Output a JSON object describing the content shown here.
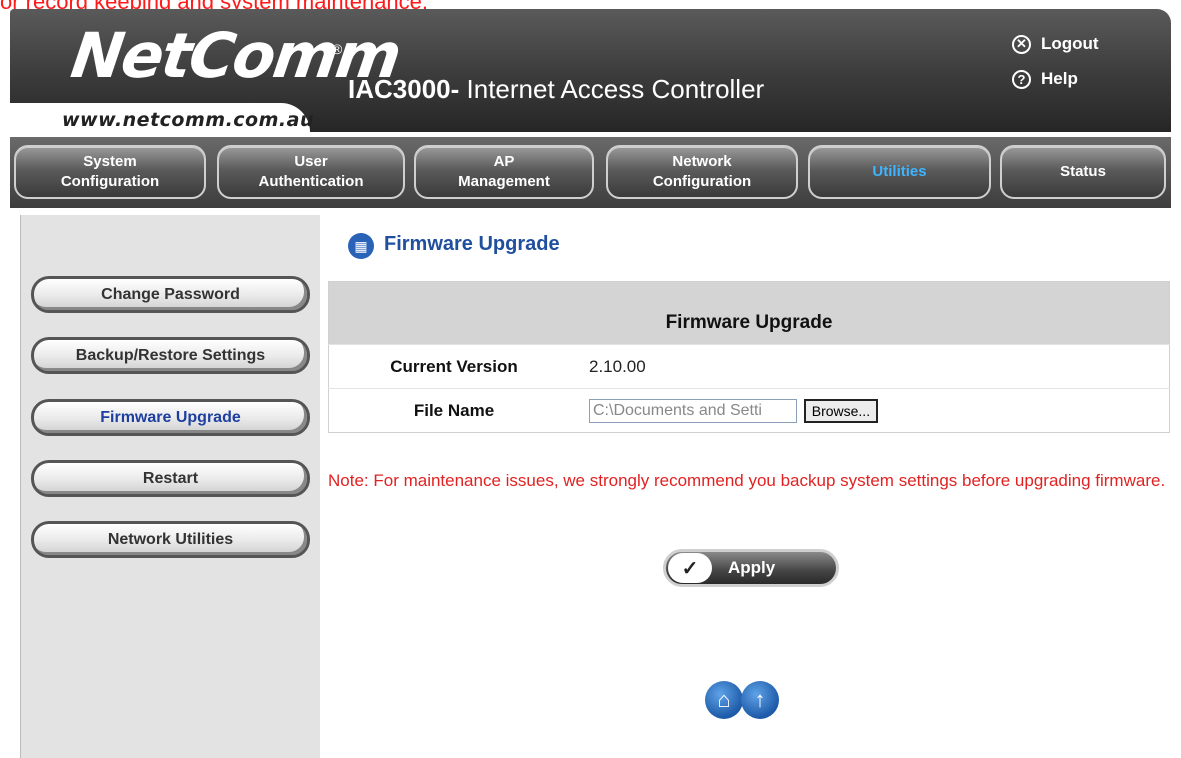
{
  "caption_top": "or record keeping and system maintenance.",
  "header": {
    "logo": "NetComm",
    "logo_reg": "®",
    "url": "www.netcomm.com.au",
    "product_bold": "IAC3000-",
    "product_rest": " Internet Access Controller",
    "logout_icon": "x-circle-icon",
    "logout": "Logout",
    "help_icon": "question-circle-icon",
    "help": "Help"
  },
  "tabs": [
    {
      "label_1": "System",
      "label_2": "Configuration"
    },
    {
      "label_1": "User",
      "label_2": "Authentication"
    },
    {
      "label_1": "AP",
      "label_2": "Management"
    },
    {
      "label_1": "Network",
      "label_2": "Configuration"
    },
    {
      "label_1": "Utilities",
      "label_2": ""
    },
    {
      "label_1": "Status",
      "label_2": ""
    }
  ],
  "active_tab": "Utilities",
  "sidebar": {
    "items": [
      {
        "label": "Change Password"
      },
      {
        "label": "Backup/Restore Settings"
      },
      {
        "label": "Firmware Upgrade"
      },
      {
        "label": "Restart"
      },
      {
        "label": "Network Utilities"
      }
    ],
    "active": "Firmware Upgrade"
  },
  "page": {
    "title_icon": "grid-icon",
    "title": "Firmware Upgrade",
    "table_header": "Firmware Upgrade",
    "current_version_label": "Current Version",
    "current_version_value": "2.10.00",
    "file_name_label": "File Name",
    "file_name_value": "C:\\Documents and Setti",
    "browse_label": "Browse...",
    "note": "Note: For maintenance issues, we strongly recommend you backup system settings before upgrading firmware.",
    "apply_label": "Apply",
    "apply_check": "✓"
  },
  "footer_icons": [
    "home-icon",
    "up-arrow-icon"
  ],
  "colors": {
    "active_tab": "#3fb4ff",
    "title_blue": "#1f4f9e",
    "note_red": "#e22222",
    "sidebar_bg": "#e3e3e3"
  }
}
